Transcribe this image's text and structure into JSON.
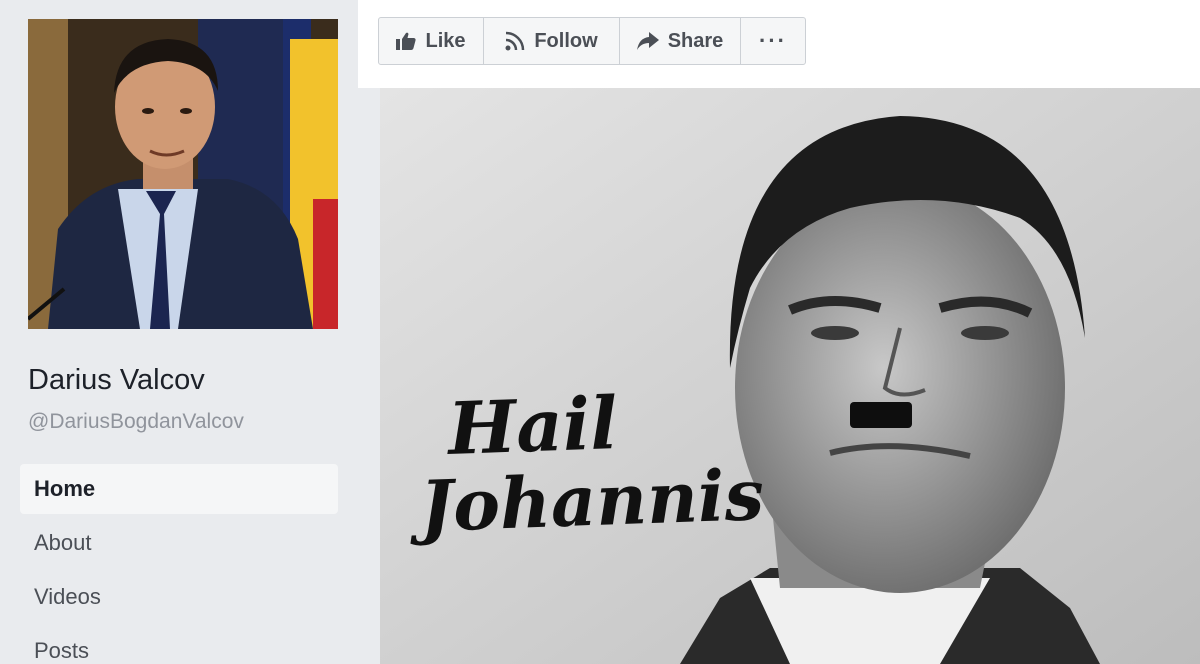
{
  "profile": {
    "name": "Darius Valcov",
    "handle": "@DariusBogdanValcov"
  },
  "nav": {
    "items": [
      {
        "label": "Home",
        "active": true
      },
      {
        "label": "About"
      },
      {
        "label": "Videos"
      },
      {
        "label": "Posts"
      }
    ]
  },
  "actions": {
    "like": "Like",
    "follow": "Follow",
    "share": "Share",
    "more": "···"
  },
  "cover": {
    "line1": "Hail",
    "line2": "Johannis"
  },
  "icons": {
    "like": "thumbs-up-icon",
    "follow": "rss-icon",
    "share": "share-arrow-icon"
  }
}
